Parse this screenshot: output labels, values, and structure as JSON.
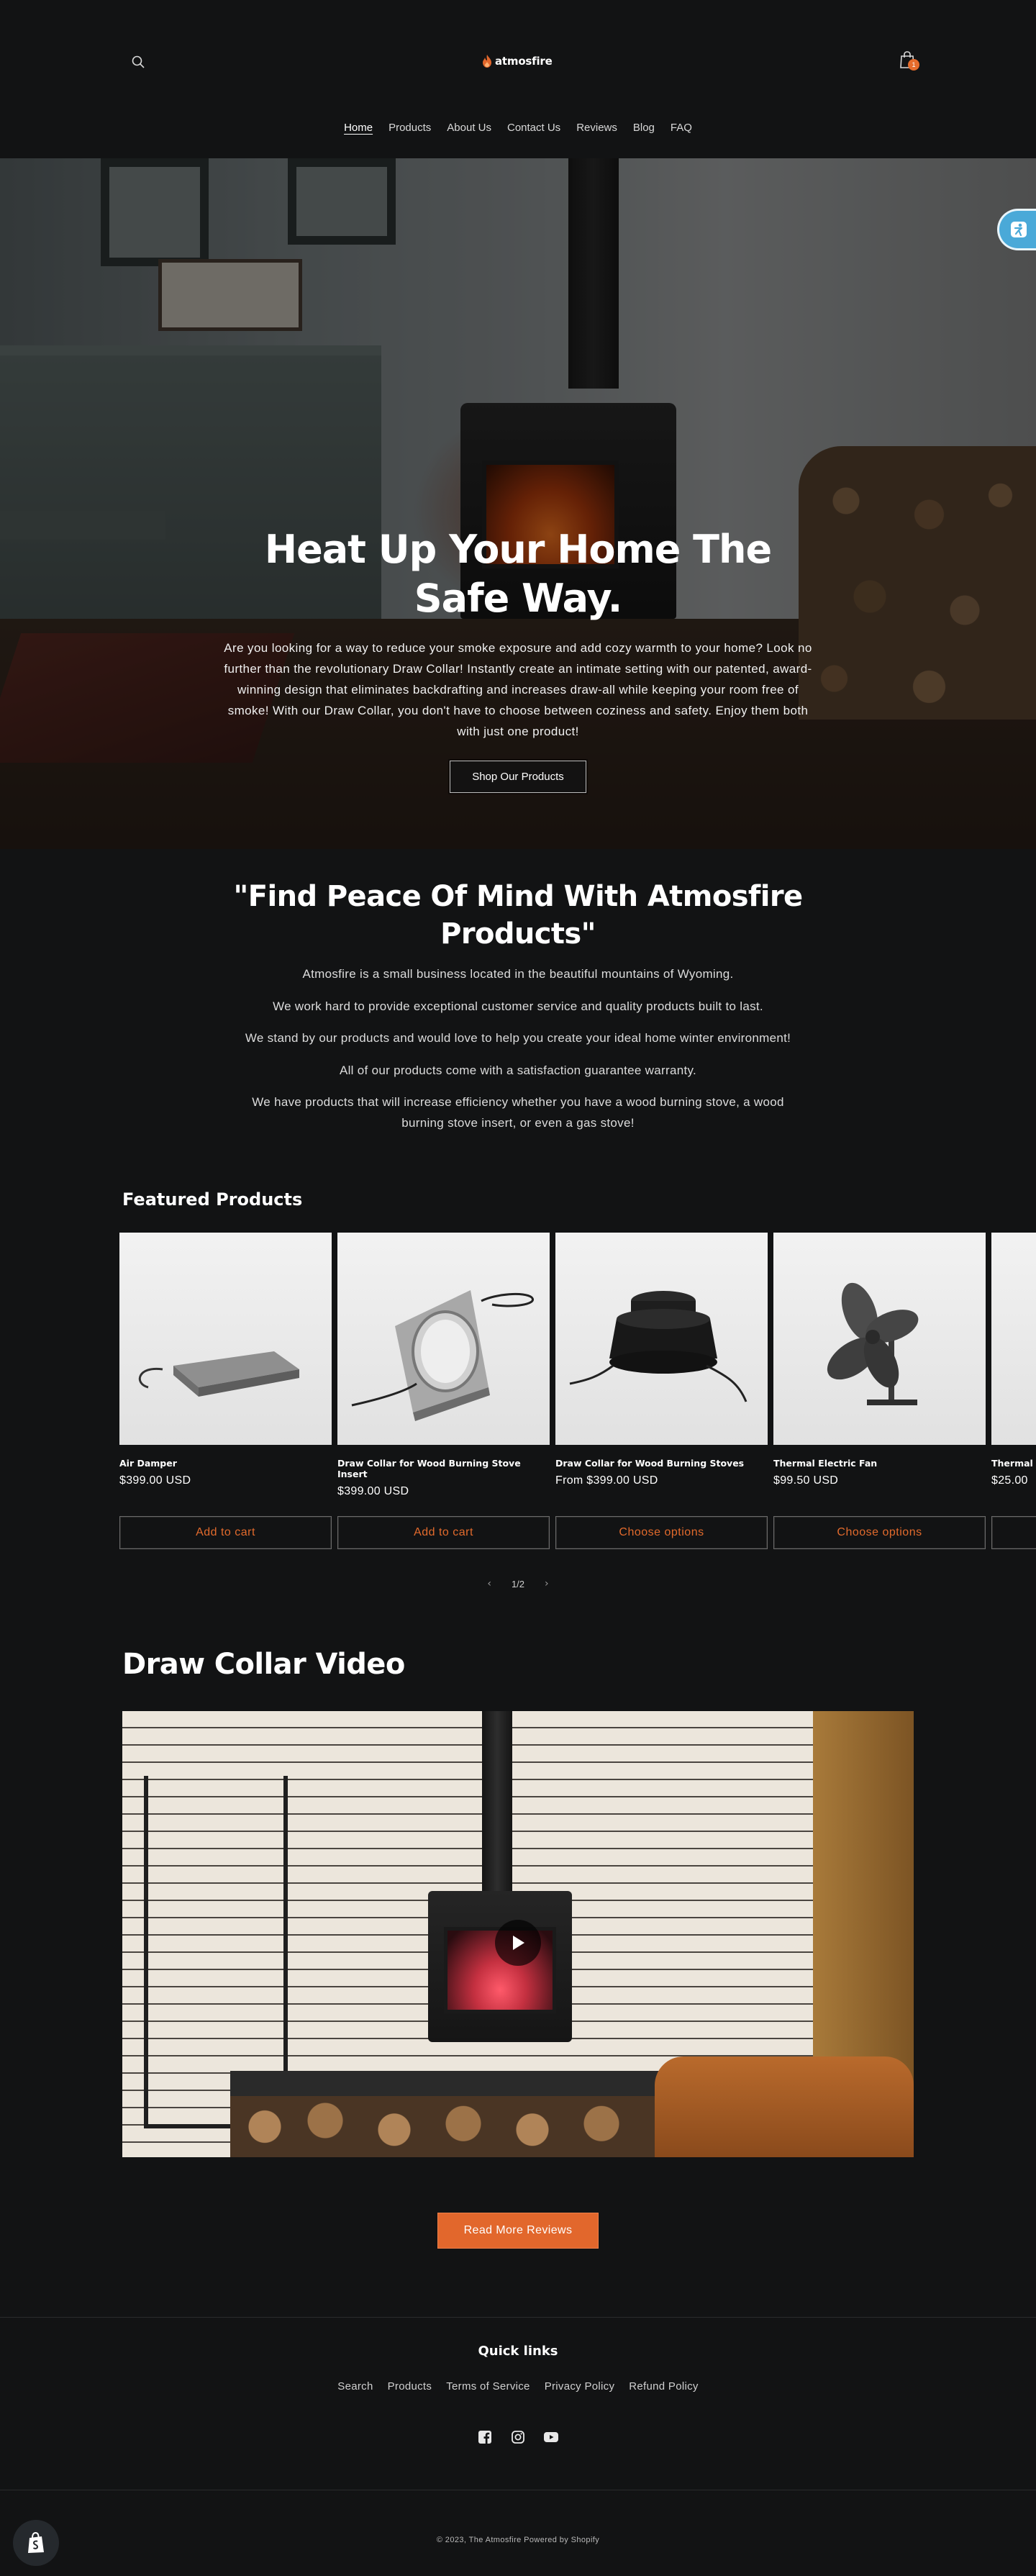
{
  "brand": {
    "logo_text": "atmosfire",
    "accent_color": "#e2672c",
    "background_color": "#121314"
  },
  "header": {
    "search_icon": "search-icon",
    "cart_icon": "shopping-bag-icon",
    "cart_count": "1"
  },
  "nav": {
    "items": [
      {
        "label": "Home",
        "active": true
      },
      {
        "label": "Products",
        "active": false
      },
      {
        "label": "About Us",
        "active": false
      },
      {
        "label": "Contact Us",
        "active": false
      },
      {
        "label": "Reviews",
        "active": false
      },
      {
        "label": "Blog",
        "active": false
      },
      {
        "label": "FAQ",
        "active": false
      }
    ]
  },
  "hero": {
    "title": "Heat Up Your Home The Safe Way.",
    "text": "Are you looking for a way to reduce your smoke exposure and add cozy warmth to your home? Look no further than the revolutionary Draw Collar! Instantly create an intimate setting with our patented, award-winning design that eliminates backdrafting and increases draw-all while keeping your room free of smoke! With our Draw Collar, you don't have to choose between coziness and safety. Enjoy them both with just one product!",
    "button_label": "Shop Our Products"
  },
  "about": {
    "title": "\"Find Peace Of Mind With Atmosfire Products\"",
    "paragraphs": [
      "Atmosfire is a small business located in the beautiful mountains of Wyoming.",
      "We work hard to provide exceptional customer service and quality products built to last.",
      "We stand by our products and would love to help you create your ideal home winter environment!",
      "All of our products come with a satisfaction guarantee warranty.",
      "We have products that will increase efficiency whether you have a wood burning stove, a wood burning stove insert, or even a gas stove!"
    ]
  },
  "featured": {
    "title": "Featured Products",
    "products": [
      {
        "name": "Air Damper",
        "price": "$399.00 USD",
        "button": "Add to cart"
      },
      {
        "name": "Draw Collar for Wood Burning Stove Insert",
        "price": "$399.00 USD",
        "button": "Add to cart"
      },
      {
        "name": "Draw Collar for Wood Burning Stoves",
        "price": "From $399.00 USD",
        "button": "Choose options"
      },
      {
        "name": "Thermal Electric Fan",
        "price": "$99.50 USD",
        "button": "Choose options"
      },
      {
        "name": "Thermal",
        "price": "$25.00",
        "button": ""
      }
    ],
    "slider": {
      "counter": "1/2",
      "prev_icon": "chevron-left-icon",
      "next_icon": "chevron-right-icon"
    }
  },
  "video": {
    "title": "Draw Collar Video",
    "play_icon": "play-icon"
  },
  "reviews": {
    "button_label": "Read More Reviews"
  },
  "footer": {
    "quick_links_title": "Quick links",
    "links": [
      "Search",
      "Products",
      "Terms of Service",
      "Privacy Policy",
      "Refund Policy"
    ],
    "social_icons": [
      "facebook-icon",
      "instagram-icon",
      "youtube-icon"
    ],
    "copyright": "© 2023, The Atmosfire Powered by Shopify"
  }
}
